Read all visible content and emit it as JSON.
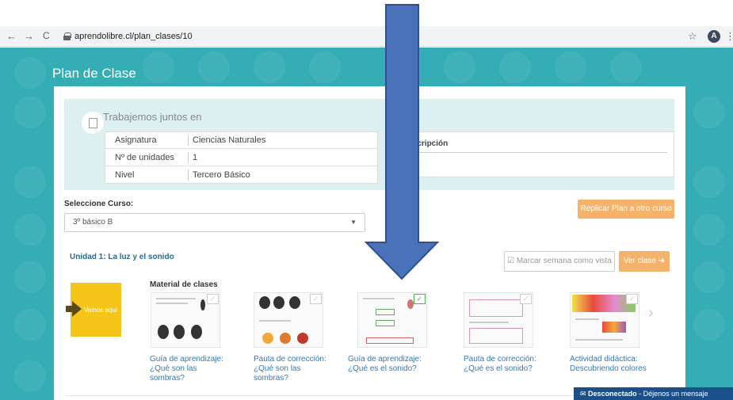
{
  "browser": {
    "back_icon": "←",
    "forward_icon": "→",
    "reload_icon": "C",
    "url": "aprendolibre.cl/plan_clases/10",
    "star_icon": "☆",
    "avatar_letter": "A",
    "menu_icon": "⋮"
  },
  "page": {
    "title": "Plan de Clase",
    "info": {
      "title": "Trabajemos juntos en",
      "rows": [
        {
          "key": "Asignatura",
          "value": "Ciencias Naturales"
        },
        {
          "key": "Nº de unidades",
          "value": "1"
        },
        {
          "key": "Nivel",
          "value": "Tercero Básico"
        }
      ],
      "description_label": "Descripción"
    },
    "select_label": "Seleccione Curso:",
    "select_value": "3º básico B",
    "replicate_button": "Replicar Plan a otro curso",
    "unit_title": "Unidad 1: La luz y el sonido",
    "mark_week_button": "Marcar semana como vista",
    "view_class_button": "Ver clase",
    "here_label": "Vamos aquí",
    "material_title": "Material de clases",
    "materials": [
      {
        "label": "Guía de aprendizaje: ¿Qué son las sombras?",
        "checked": false
      },
      {
        "label": "Pauta de corrección: ¿Qué son las sombras?",
        "checked": false
      },
      {
        "label": "Guía de aprendizaje: ¿Qué es el sonido?",
        "checked": true
      },
      {
        "label": "Pauta de corrección: ¿Qué es el sonido?",
        "checked": false
      },
      {
        "label": "Actividad didáctica: Descubriendo colores",
        "checked": false
      }
    ],
    "next_icon": "›"
  },
  "chat": {
    "status": "Desconectado",
    "message": " - Déjenos un mensaje"
  },
  "colors": {
    "teal": "#34adb5",
    "orange": "#f5b26b",
    "overlay_arrow": "#4a72b8",
    "chat": "#1b4f8a"
  }
}
